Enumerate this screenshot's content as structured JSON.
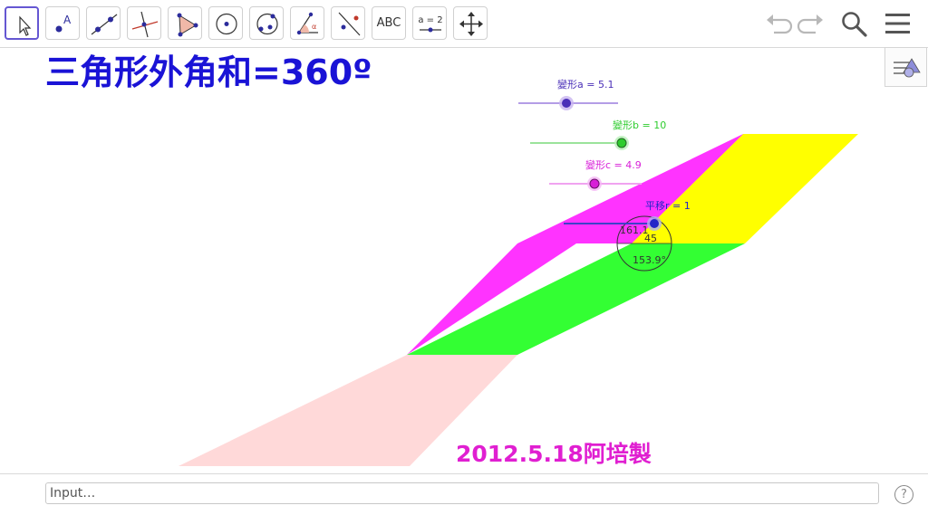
{
  "toolbar": {
    "tools": [
      {
        "name": "move-tool",
        "icon": "cursor-arrow-icon",
        "active": true
      },
      {
        "name": "point-tool",
        "icon": "point-icon"
      },
      {
        "name": "line-tool",
        "icon": "line-through-points-icon"
      },
      {
        "name": "perpendicular-line-tool",
        "icon": "perpendicular-line-icon"
      },
      {
        "name": "polygon-tool",
        "icon": "polygon-icon"
      },
      {
        "name": "circle-center-point-tool",
        "icon": "circle-center-icon"
      },
      {
        "name": "circle-three-points-tool",
        "icon": "circle-three-points-icon"
      },
      {
        "name": "angle-tool",
        "icon": "angle-icon"
      },
      {
        "name": "reflect-tool",
        "icon": "reflect-about-line-icon"
      },
      {
        "name": "text-tool",
        "icon": "text-icon",
        "label": "ABC"
      },
      {
        "name": "slider-tool",
        "icon": "slider-icon",
        "label": "a = 2"
      },
      {
        "name": "move-graphics-view-tool",
        "icon": "move-arrows-icon"
      }
    ],
    "right_icons": [
      "undo-icon",
      "redo-icon",
      "search-icon",
      "menu-icon"
    ]
  },
  "canvas": {
    "heading": "三角形外角和=360º",
    "signature": "2012.5.18阿培製",
    "sliders": [
      {
        "label": "變形a = 5.1",
        "value": 5.1,
        "color": "#4a2fb8"
      },
      {
        "label": "變形b = 10",
        "value": 10,
        "color": "#2ecc2e"
      },
      {
        "label": "變形c = 4.9",
        "value": 4.9,
        "color": "#d81fd8"
      },
      {
        "label": "平移r = 1",
        "value": 1,
        "color": "#2424c8"
      }
    ],
    "angle_labels": [
      "161.1",
      "45",
      "153.9°"
    ],
    "colors": {
      "magenta": "#ff33ff",
      "yellow": "#ffff00",
      "green": "#33ff33",
      "pink": "#ffd9d9"
    }
  },
  "input_bar": {
    "placeholder": "Input…",
    "help_label": "?"
  }
}
